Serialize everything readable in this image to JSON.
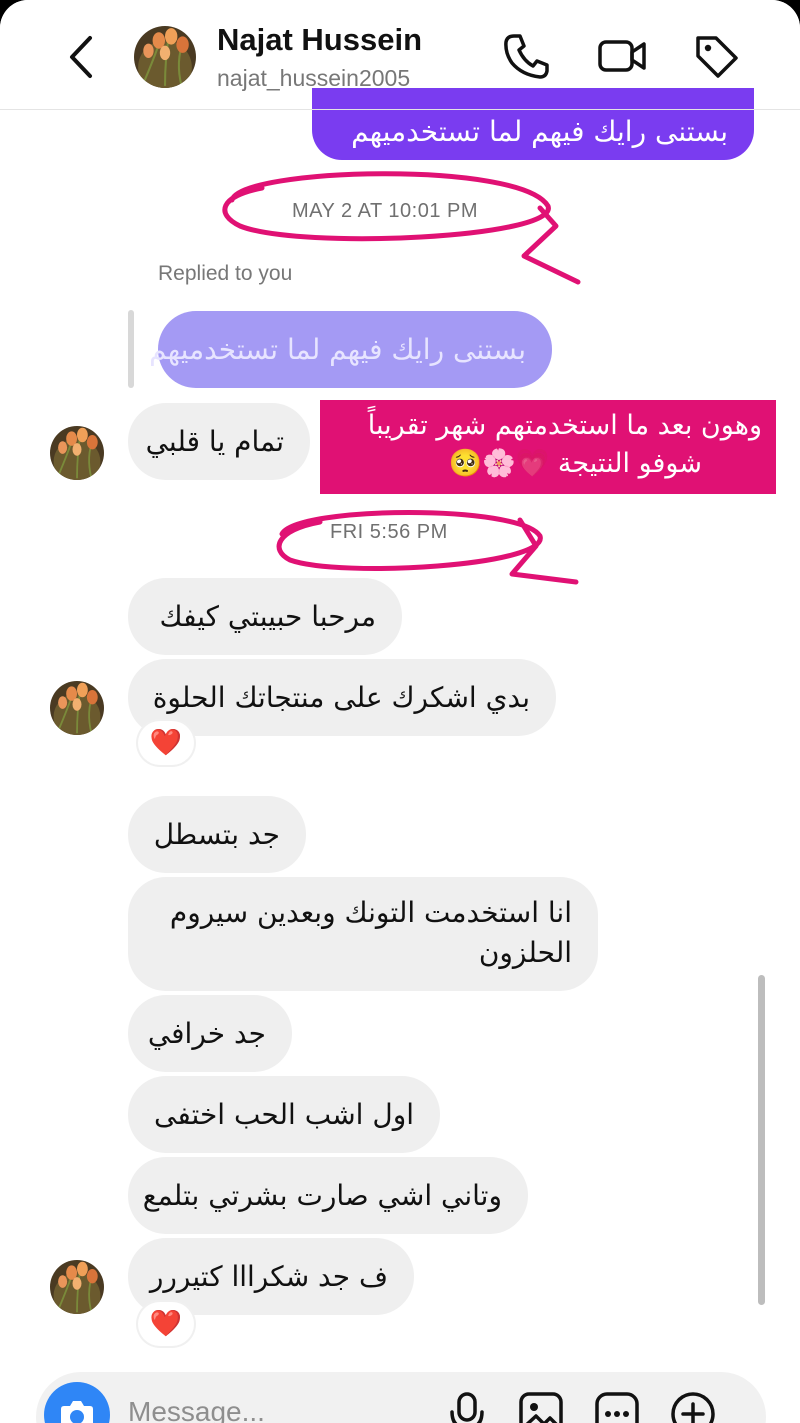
{
  "header": {
    "name": "Najat Hussein",
    "handle": "najat_hussein2005",
    "icons": [
      "back-chevron-icon",
      "phone-icon",
      "video-icon",
      "tag-icon"
    ]
  },
  "messages": {
    "top_out": "بستنى رايك فيهم لما تستخدميهم",
    "ts1": "MAY 2 AT 10:01 PM",
    "replied_label": "Replied to you",
    "replied_quote": "بستنى رايك فيهم لما تستخدميهم",
    "reply1": "تمام يا قلبي",
    "ts2": "FRI 5:56 PM",
    "m1": "مرحبا حبيبتي كيفك",
    "m2": "بدي اشكرك على منتجاتك الحلوة",
    "m3": "جد بتسطل",
    "m4": "انا استخدمت التونك وبعدين سيروم الحلزون",
    "m5": "جد خرافي",
    "m6": "اول اشب الحب اختفى",
    "m7": "وتاني اشي صارت بشرتي بتلمع",
    "m8": "ف جد شكرااا كتيررر",
    "reaction": "❤️"
  },
  "annotation": {
    "pink_text_line1": "وهون بعد ما استخدمتهم شهر تقريباً",
    "pink_text_line2": "شوفو النتيجة 💗🌸🥺",
    "color": "#e01174"
  },
  "composer": {
    "placeholder": "Message...",
    "icons": [
      "camera-icon",
      "microphone-icon",
      "gallery-icon",
      "sticker-icon",
      "plus-icon"
    ]
  },
  "colors": {
    "outgoing": "#7a3cf0",
    "incoming": "#efefef",
    "camera": "#2f86f6"
  }
}
